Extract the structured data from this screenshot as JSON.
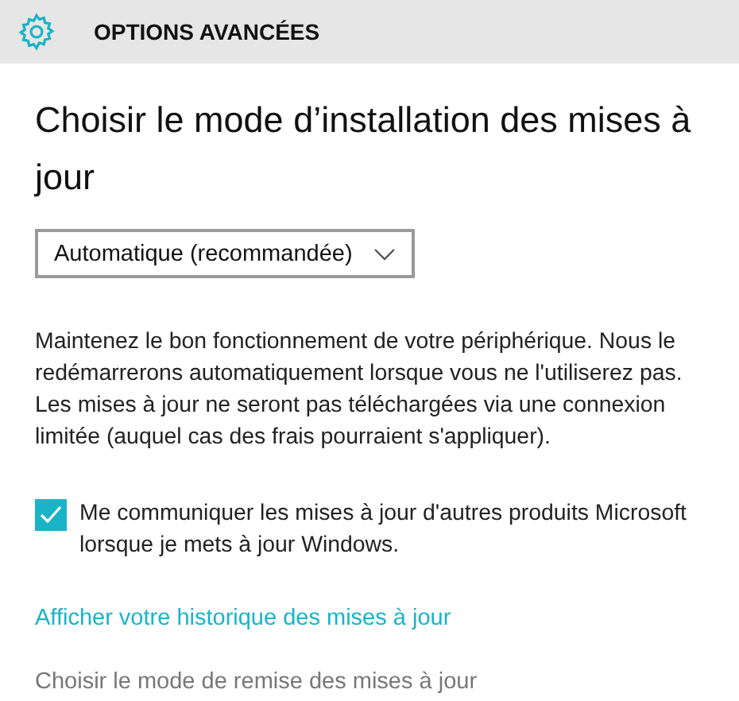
{
  "header": {
    "title": "OPTIONS AVANCÉES"
  },
  "heading": "Choisir le mode d’installation des mises à jour",
  "dropdown": {
    "value": "Automatique (recommandée)"
  },
  "description": "Maintenez le bon fonctionnement de votre périphérique. Nous le redémarrerons automatiquement lorsque vous ne l'utiliserez pas. Les mises à jour ne seront pas téléchargées via une connexion limitée (auquel cas des frais pourraient s'appliquer).",
  "checkbox": {
    "label": "Me communiquer les mises à jour d'autres produits Microsoft lorsque je mets à jour Windows.",
    "checked": true
  },
  "links": [
    {
      "label": "Afficher votre historique des mises à jour",
      "disabled": false
    },
    {
      "label": "Choisir le mode de remise des mises à jour",
      "disabled": true
    }
  ]
}
